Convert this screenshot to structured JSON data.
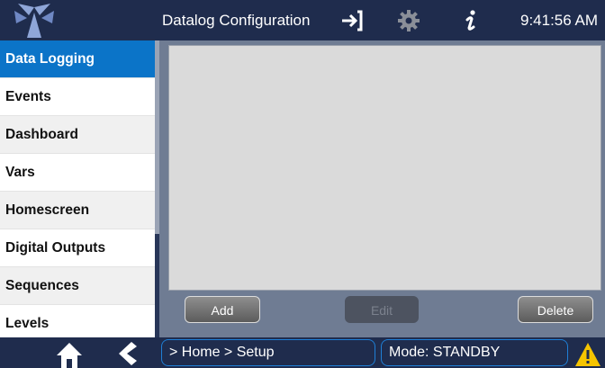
{
  "header": {
    "title": "Datalog Configuration",
    "time": "9:41:56 AM",
    "icons": [
      "logo-icon",
      "sign-in-icon",
      "gear-icon",
      "info-icon"
    ]
  },
  "sidebar": {
    "items": [
      {
        "label": "Data Logging",
        "active": true
      },
      {
        "label": "Events"
      },
      {
        "label": "Dashboard"
      },
      {
        "label": "Vars"
      },
      {
        "label": "Homescreen"
      },
      {
        "label": "Digital Outputs"
      },
      {
        "label": "Sequences"
      },
      {
        "label": "Levels"
      }
    ]
  },
  "actions": {
    "add_label": "Add",
    "edit_label": "Edit",
    "delete_label": "Delete",
    "edit_enabled": false
  },
  "footer": {
    "breadcrumb": "> Home > Setup",
    "mode": "Mode: STANDBY",
    "icons": [
      "home-icon",
      "back-arrow-icon",
      "warning-icon"
    ]
  },
  "colors": {
    "header_bg": "#1f2c4d",
    "active_item": "#0b74c8",
    "accent_border": "#1f7fd6",
    "warning": "#f5c400"
  }
}
